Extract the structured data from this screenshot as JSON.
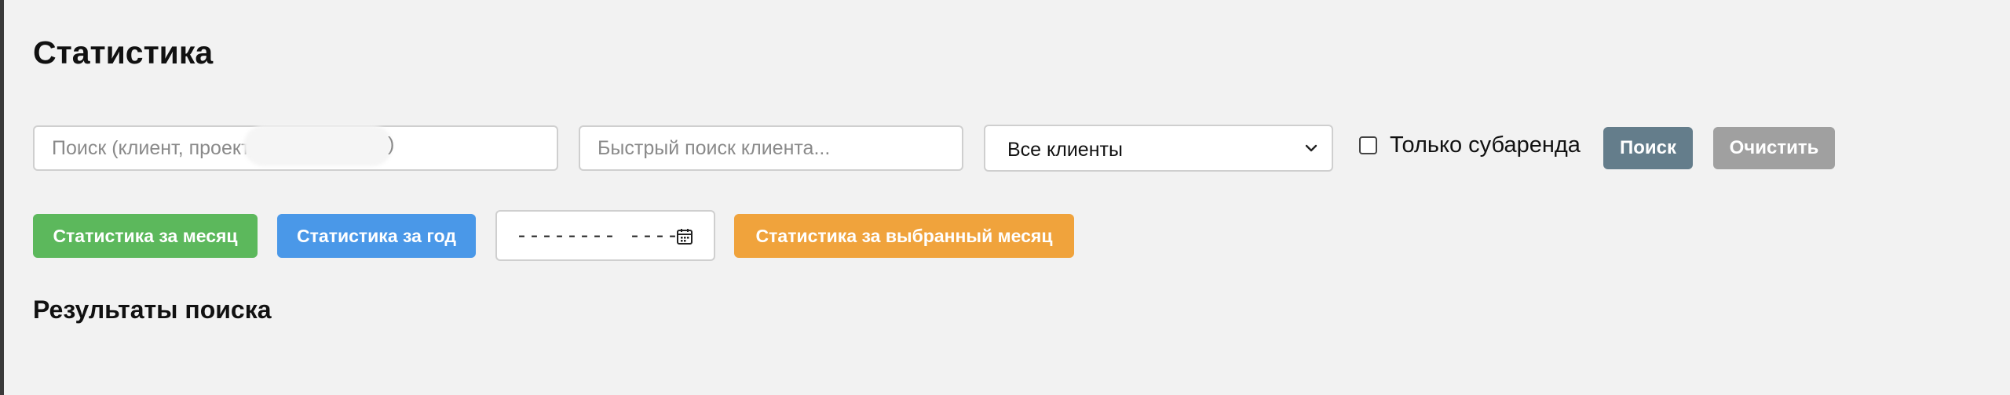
{
  "page": {
    "title": "Статистика",
    "results_heading": "Результаты поиска"
  },
  "filters": {
    "search_placeholder": "Поиск (клиент, проект, ",
    "search_placeholder_tail": ")",
    "quick_client_placeholder": "Быстрый поиск клиента...",
    "client_select": {
      "selected": "Все клиенты"
    },
    "sublease_only_label": "Только субаренда",
    "sublease_only_checked": false,
    "search_button": "Поиск",
    "clear_button": "Очистить"
  },
  "stats": {
    "month_button": "Статистика за месяц",
    "year_button": "Статистика за год",
    "month_picker_value": "-------- ----",
    "selected_month_button": "Статистика за выбранный месяц"
  },
  "colors": {
    "background": "#f2f2f2",
    "search_button": "#647d8b",
    "clear_button": "#a0a0a0",
    "month_button": "#5cb85c",
    "year_button": "#4a98e8",
    "selected_month_button": "#f0a33c"
  },
  "icons": {
    "select_chevron": "chevron-down-icon",
    "month_picker": "calendar-icon"
  }
}
